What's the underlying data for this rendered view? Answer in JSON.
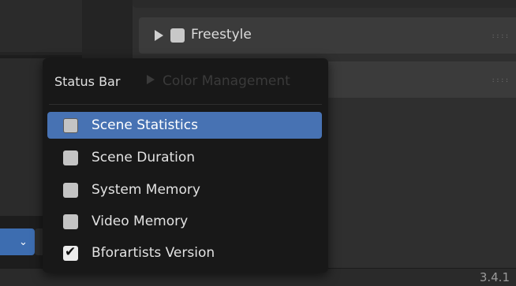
{
  "properties": {
    "panels": [
      {
        "label": "Freestyle",
        "grip": "::::"
      },
      {
        "label": "Color Management",
        "grip": "::::"
      }
    ]
  },
  "popup": {
    "title": "Status Bar",
    "items": [
      {
        "label": "Scene Statistics",
        "checked": false,
        "active": true
      },
      {
        "label": "Scene Duration",
        "checked": false,
        "active": false
      },
      {
        "label": "System Memory",
        "checked": false,
        "active": false
      },
      {
        "label": "Video Memory",
        "checked": false,
        "active": false
      },
      {
        "label": "Bforartists Version",
        "checked": true,
        "active": false
      }
    ]
  },
  "status_bar": {
    "version": "3.4.1"
  },
  "icons": {
    "checkmark": "✔",
    "chevron_down": "⌄"
  },
  "colors": {
    "accent": "#4772b3"
  }
}
